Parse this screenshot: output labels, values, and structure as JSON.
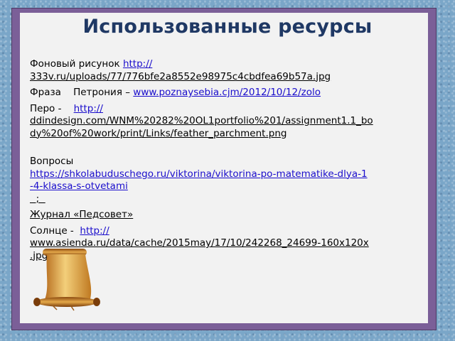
{
  "title": "Использованные ресурсы",
  "resources": {
    "background": {
      "label": "Фоновый рисунок ",
      "link_part1": "http://",
      "link_part2": "333v.ru/uploads/77/776bfe2a8552e98975c4cbdfea69b57a.jpg"
    },
    "phrase": {
      "label": "Фраза    Петрония – ",
      "link": "www.poznaysebia.cjm/2012/10/12/zolo"
    },
    "feather": {
      "label": "Перо -    ",
      "link_part1": "http://",
      "link_part2": "ddindesign.com/WNM%20282%20OL1portfolio%201/assignment1.1_bo",
      "link_part3": "dy%20of%20work/print/Links/feather_parchment.png"
    },
    "questions": {
      "label": "Вопросы",
      "link_part1": "https://shkolabuduschego.ru/viktorina/viktorina-po-matematike-dlya-1",
      "link_part2": "-4-klassa-s-otvetami",
      "trailing": "  ;  "
    },
    "journal": {
      "label": "Журнал «Педсовет»"
    },
    "sun": {
      "label": "Солнце -  ",
      "link_part1": "http://",
      "link_part2": "www.asienda.ru/data/cache/2015may/17/10/242268_24699-160x120x",
      "link_part3": ".jpg"
    }
  },
  "decoration": {
    "scroll_icon": "scroll-icon"
  }
}
